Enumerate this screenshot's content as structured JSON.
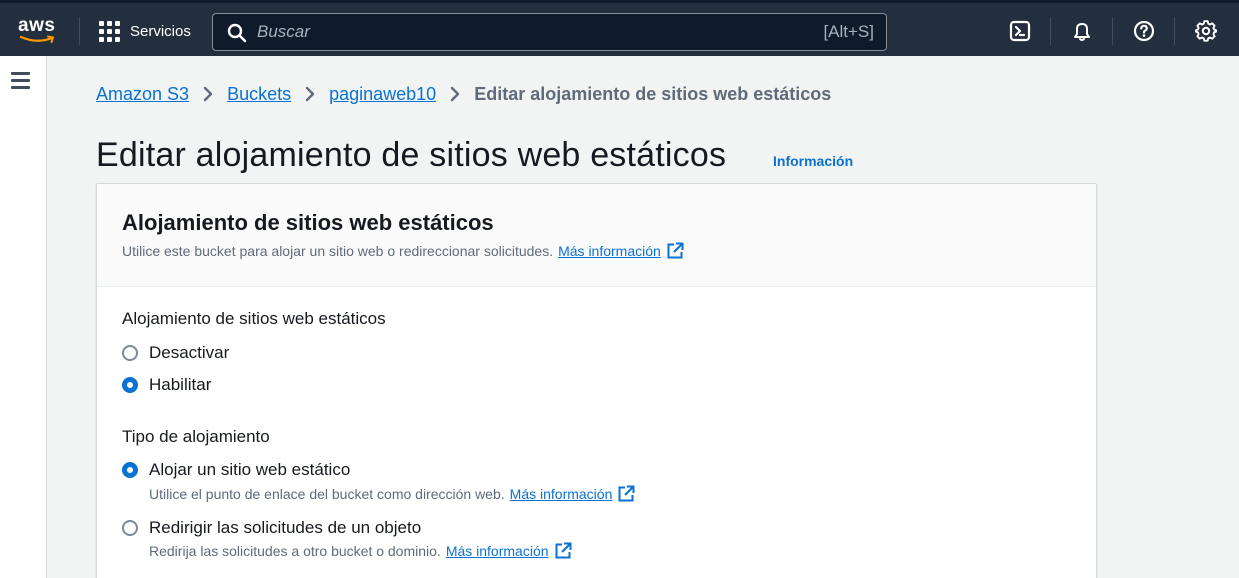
{
  "topnav": {
    "logo_text": "aws",
    "services_label": "Servicios",
    "search_placeholder": "Buscar",
    "search_shortcut": "[Alt+S]",
    "icons": [
      "cloudshell-icon",
      "bell-icon",
      "help-icon",
      "settings-icon"
    ]
  },
  "breadcrumb": {
    "items": [
      "Amazon S3",
      "Buckets",
      "paginaweb10"
    ],
    "current": "Editar alojamiento de sitios web estáticos"
  },
  "page": {
    "title": "Editar alojamiento de sitios web estáticos",
    "info_link": "Información"
  },
  "panel": {
    "title": "Alojamiento de sitios web estáticos",
    "description": "Utilice este bucket para alojar un sitio web o redireccionar solicitudes.",
    "more_info": "Más información"
  },
  "hosting": {
    "label": "Alojamiento de sitios web estáticos",
    "options": [
      {
        "label": "Desactivar",
        "checked": false
      },
      {
        "label": "Habilitar",
        "checked": true
      }
    ]
  },
  "hosting_type": {
    "label": "Tipo de alojamiento",
    "options": [
      {
        "label": "Alojar un sitio web estático",
        "description": "Utilice el punto de enlace del bucket como dirección web.",
        "more_info": "Más información",
        "checked": true
      },
      {
        "label": "Redirigir las solicitudes de un objeto",
        "description": "Redirija las solicitudes a otro bucket o dominio.",
        "more_info": "Más información",
        "checked": false
      }
    ]
  },
  "colors": {
    "nav_bg": "#232f3e",
    "link": "#0972d3",
    "text": "#16191f",
    "secondary_text": "#5f6b7a",
    "page_bg": "#f2f3f3"
  }
}
